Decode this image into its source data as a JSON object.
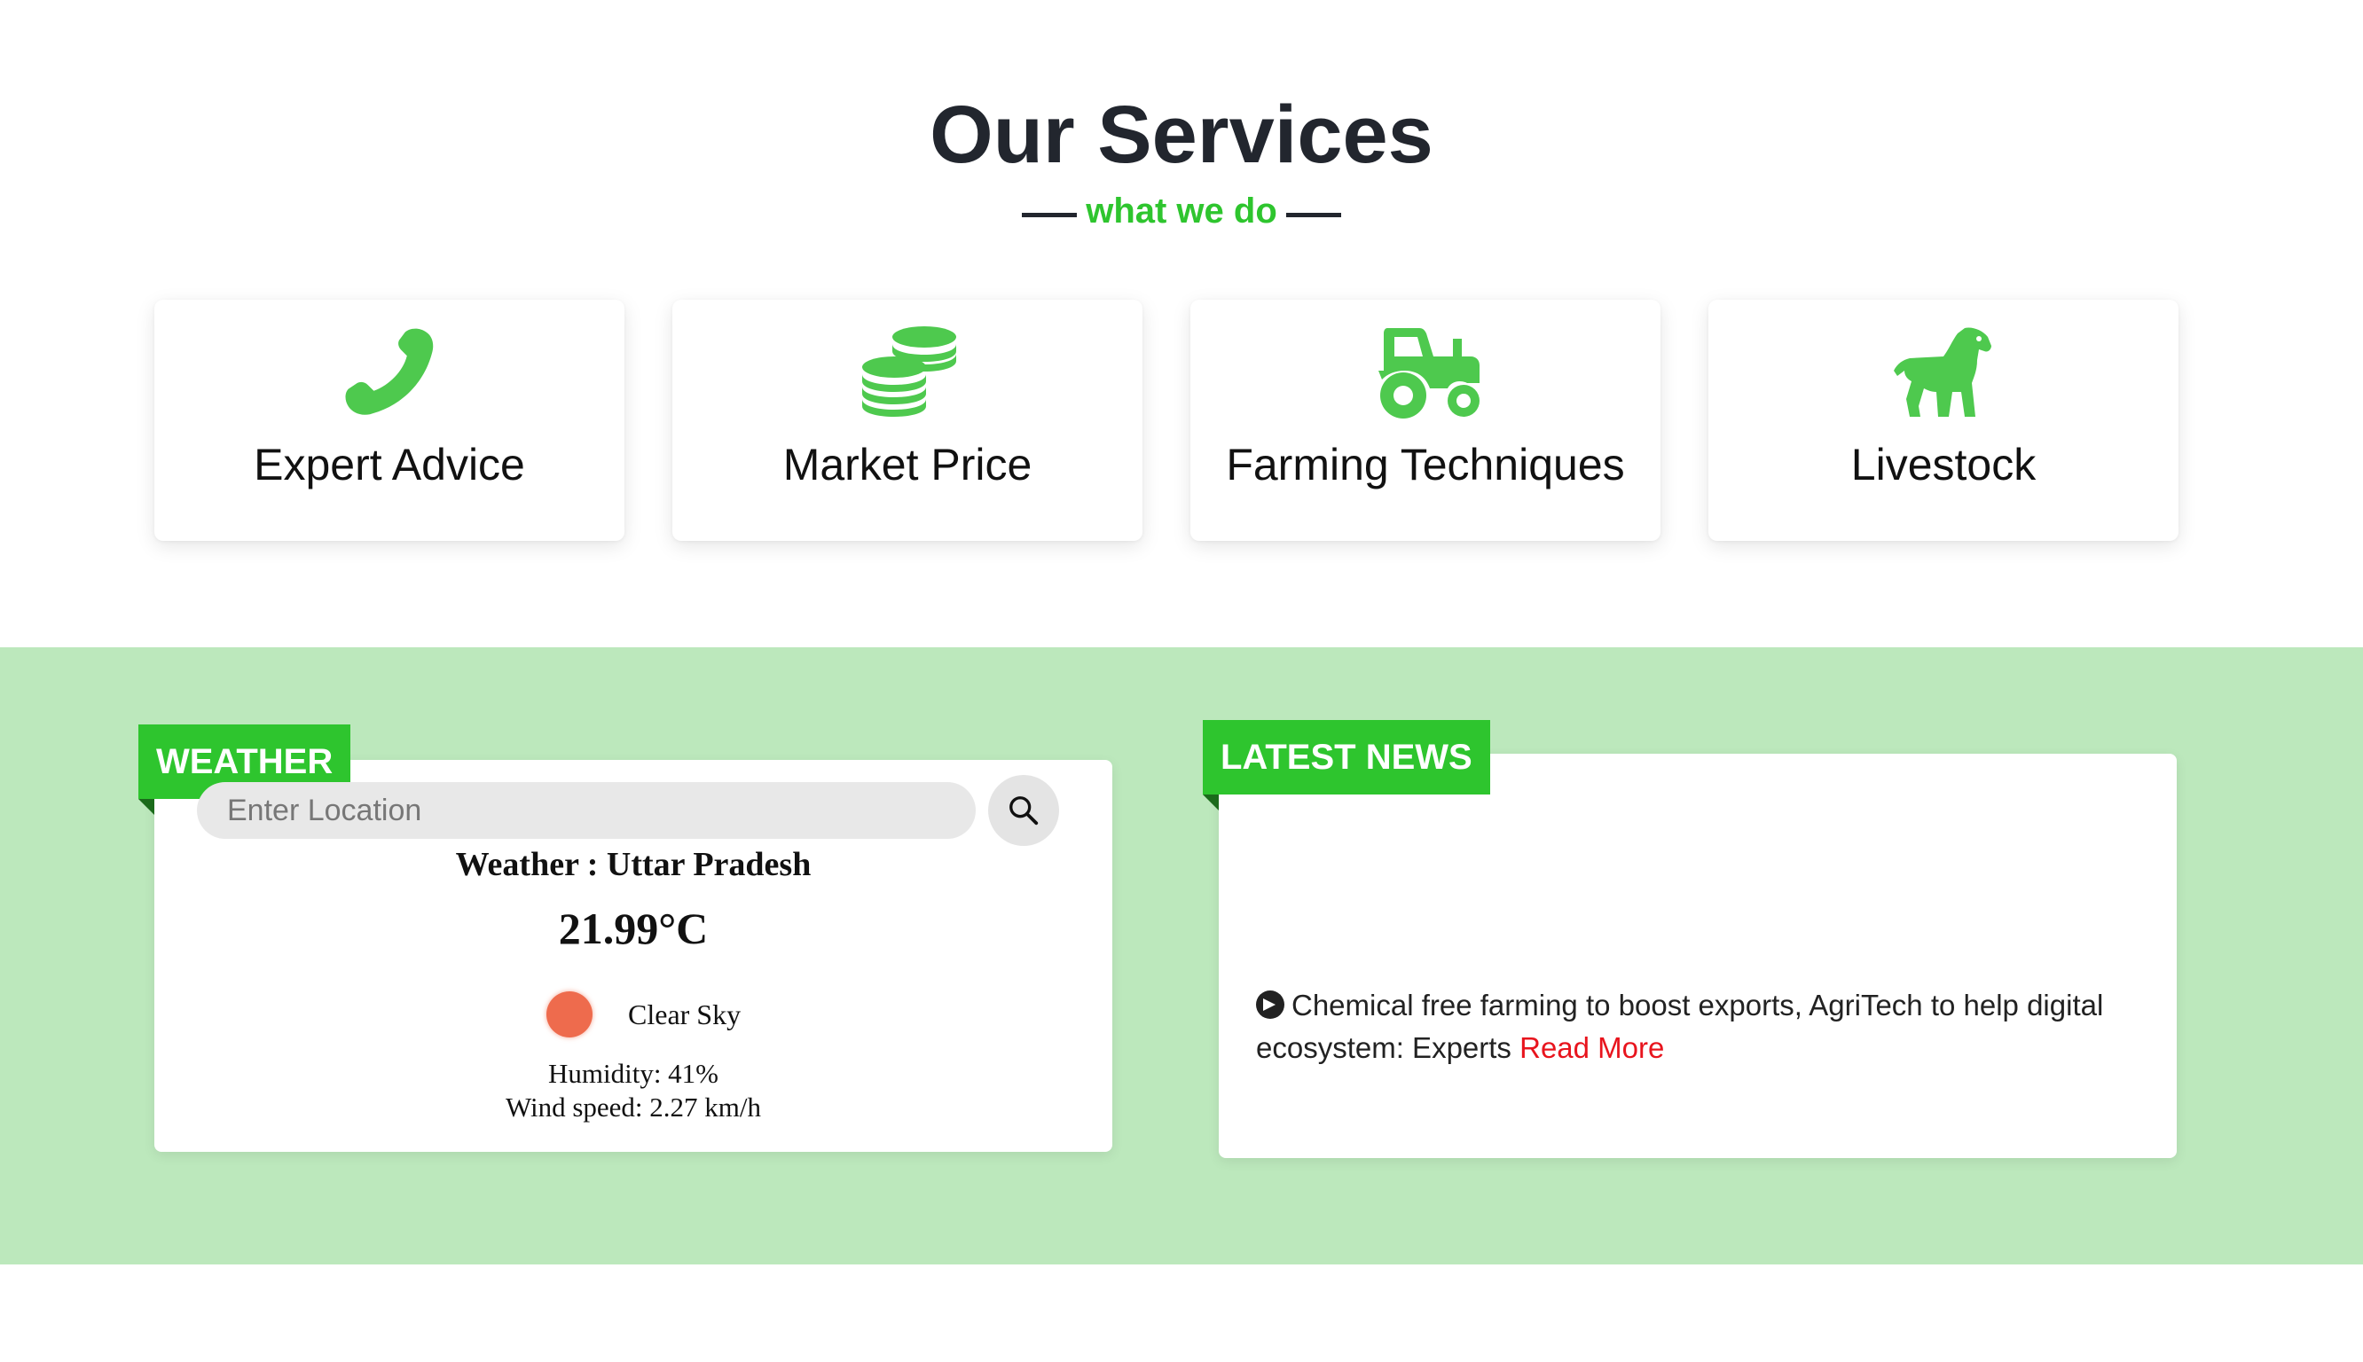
{
  "services": {
    "title": "Our Services",
    "subtitle": "what we do",
    "accent_color": "#2ec52e",
    "cards": [
      {
        "label": "Expert Advice",
        "icon": "phone-icon"
      },
      {
        "label": "Market Price",
        "icon": "coins-icon"
      },
      {
        "label": "Farming Techniques",
        "icon": "tractor-icon"
      },
      {
        "label": "Livestock",
        "icon": "horse-icon"
      }
    ]
  },
  "weather": {
    "ribbon": "WEATHER",
    "search_placeholder": "Enter Location",
    "city_line": "Weather : Uttar Pradesh",
    "temperature": "21.99°C",
    "condition": "Clear Sky",
    "condition_icon": "sun-icon",
    "humidity": "Humidity: 41%",
    "wind": "Wind speed: 2.27 km/h"
  },
  "news": {
    "ribbon": "LATEST NEWS",
    "items": [
      {
        "text": "Chemical free farming to boost exports, AgriTech to help digital ecosystem: Experts",
        "link": "Read More"
      }
    ]
  },
  "colors": {
    "band_background": "#bce8bc",
    "ribbon_green": "#2ec52e",
    "link_red": "#e8141d"
  }
}
